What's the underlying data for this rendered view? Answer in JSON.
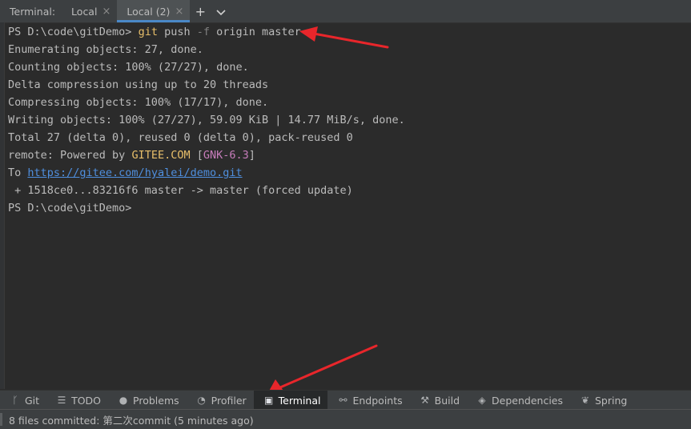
{
  "tabbar": {
    "title": "Terminal:",
    "tabs": [
      {
        "label": "Local",
        "close": "×"
      },
      {
        "label": "Local (2)",
        "close": "×"
      }
    ],
    "add_icon": "+",
    "dropdown_icon": "⌵"
  },
  "terminal": {
    "prompt1": "PS D:\\code\\gitDemo> ",
    "cmd_git": "git",
    "cmd_push": " push ",
    "cmd_flag": "-f",
    "cmd_rest": " origin master",
    "l_enum": "Enumerating objects: 27, done.",
    "l_count": "Counting objects: 100% (27/27), done.",
    "l_delta": "Delta compression using up to 20 threads",
    "l_compress": "Compressing objects: 100% (17/17), done.",
    "l_write": "Writing objects: 100% (27/27), 59.09 KiB | 14.77 MiB/s, done.",
    "l_total": "Total 27 (delta 0), reused 0 (delta 0), pack-reused 0",
    "remote_prefix": "remote: Powered by ",
    "remote_brand": "GITEE.COM",
    "remote_bracket_open": " [",
    "remote_version": "GNK-6.3",
    "remote_bracket_close": "]",
    "to_prefix": "To ",
    "to_url": "https://gitee.com/hyalei/demo.git",
    "l_update": " + 1518ce0...83216f6 master -> master (forced update)",
    "prompt2": "PS D:\\code\\gitDemo>"
  },
  "toolwindows": [
    {
      "label": "Git",
      "icon": "branch-icon",
      "glyph": "ᚴ"
    },
    {
      "label": "TODO",
      "icon": "list-icon",
      "glyph": "☰"
    },
    {
      "label": "Problems",
      "icon": "problems-icon",
      "glyph": "●"
    },
    {
      "label": "Profiler",
      "icon": "profiler-icon",
      "glyph": "◔"
    },
    {
      "label": "Terminal",
      "icon": "terminal-icon",
      "glyph": "▣"
    },
    {
      "label": "Endpoints",
      "icon": "endpoints-icon",
      "glyph": "⚯"
    },
    {
      "label": "Build",
      "icon": "hammer-icon",
      "glyph": "⚒"
    },
    {
      "label": "Dependencies",
      "icon": "dependencies-icon",
      "glyph": "◈"
    },
    {
      "label": "Spring",
      "icon": "spring-leaf-icon",
      "glyph": "❦"
    }
  ],
  "status": {
    "message": "8 files committed: 第二次commit (5 minutes ago)"
  },
  "colors": {
    "background": "#2b2b2b",
    "command": "#e8bf6a",
    "link": "#4f8fde",
    "version": "#c77dbb",
    "annotation_arrow": "#e8262b"
  }
}
